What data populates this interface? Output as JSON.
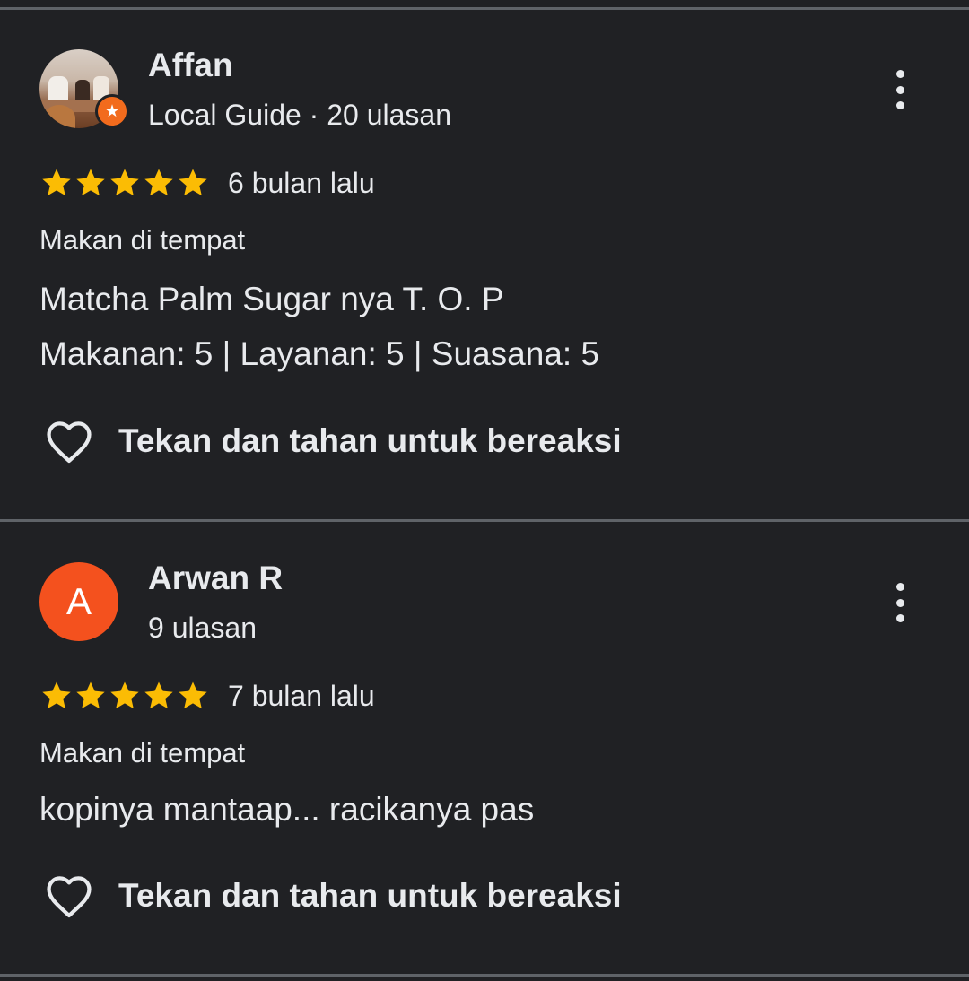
{
  "reviews": [
    {
      "name": "Affan",
      "meta": "Local Guide · 20 ulasan",
      "avatar_type": "photo",
      "badge_icon": "local-guide-star-icon",
      "rating": 5,
      "rating_max": 5,
      "time": "6 bulan lalu",
      "mode": "Makan di tempat",
      "text_lines": [
        "Matcha Palm Sugar nya T. O. P",
        "Makanan: 5 | Layanan: 5 | Suasana: 5"
      ],
      "react_label": "Tekan dan tahan untuk bereaksi"
    },
    {
      "name": "Arwan R",
      "meta": "9 ulasan",
      "avatar_type": "letter",
      "avatar_letter": "A",
      "rating": 5,
      "rating_max": 5,
      "time": "7 bulan lalu",
      "mode": "Makan di tempat",
      "text_lines": [
        "kopinya mantaap... racikanya pas"
      ],
      "react_label": "Tekan dan tahan untuk bereaksi"
    }
  ],
  "colors": {
    "background": "#202124",
    "divider": "#5f6368",
    "star": "#fbbc04",
    "avatar_letter_bg": "#f4511e",
    "badge": "#f26b1d",
    "text": "#e8eaed"
  },
  "icons": {
    "more": "more-vert-icon",
    "star": "star-icon",
    "heart": "heart-outline-icon"
  }
}
